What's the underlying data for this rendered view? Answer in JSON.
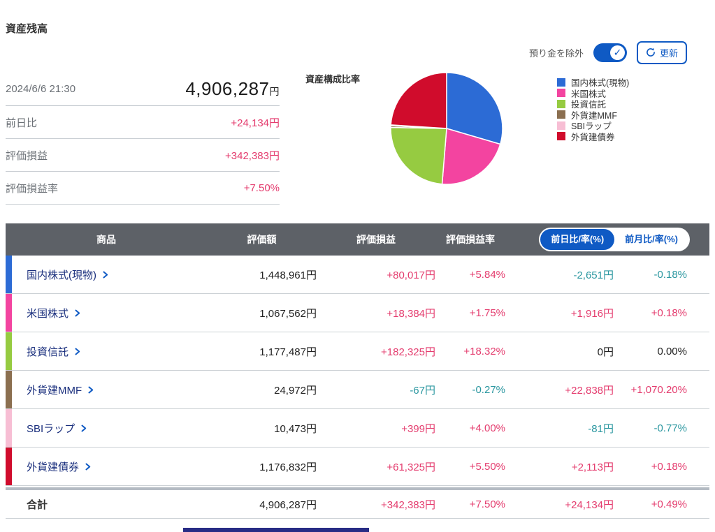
{
  "page": {
    "title": "資産残高"
  },
  "controls": {
    "toggle_label": "預り金を除外",
    "toggle_state": "on",
    "toggle_check": "✓",
    "refresh_label": "更新"
  },
  "summary": {
    "timestamp": "2024/6/6 21:30",
    "total_value": "4,906,287",
    "total_unit": "円",
    "rows": [
      {
        "label": "前日比",
        "value": "+24,134円",
        "state": "pos"
      },
      {
        "label": "評価損益",
        "value": "+342,383円",
        "state": "pos"
      },
      {
        "label": "評価損益率",
        "value": "+7.50%",
        "state": "pos"
      }
    ]
  },
  "chart_data": {
    "type": "pie",
    "title": "資産構成比率",
    "unit": "円",
    "total": 4906287,
    "legend_position": "right",
    "start_angle_deg": 0,
    "direction": "clockwise",
    "slices": [
      {
        "label": "国内株式(現物)",
        "value": 1448961,
        "percent": 29.53,
        "color": "#2c6bd5"
      },
      {
        "label": "米国株式",
        "value": 1067562,
        "percent": 21.76,
        "color": "#f344a0"
      },
      {
        "label": "投資信託",
        "value": 1177487,
        "percent": 24.0,
        "color": "#96cb41"
      },
      {
        "label": "外貨建MMF",
        "value": 24972,
        "percent": 0.51,
        "color": "#8b6f50"
      },
      {
        "label": "SBIラップ",
        "value": 10473,
        "percent": 0.21,
        "color": "#f7bed4"
      },
      {
        "label": "外貨建債券",
        "value": 1176832,
        "percent": 23.99,
        "color": "#d00c2c"
      }
    ]
  },
  "table": {
    "headers": {
      "product": "商品",
      "value": "評価額",
      "pl": "評価損益",
      "pl_rate": "評価損益率"
    },
    "period_toggle": [
      {
        "label": "前日比/率(%)",
        "selected": true
      },
      {
        "label": "前月比/率(%)",
        "selected": false
      }
    ],
    "rows": [
      {
        "product": "国内株式(現物)",
        "color": "#2c6bd5",
        "value": "1,448,961円",
        "pl": {
          "t": "+80,017円",
          "s": "pos"
        },
        "pl_rate": {
          "t": "+5.84%",
          "s": "pos"
        },
        "day": {
          "t": "-2,651円",
          "s": "neg"
        },
        "day_rate": {
          "t": "-0.18%",
          "s": "neg"
        }
      },
      {
        "product": "米国株式",
        "color": "#f344a0",
        "value": "1,067,562円",
        "pl": {
          "t": "+18,384円",
          "s": "pos"
        },
        "pl_rate": {
          "t": "+1.75%",
          "s": "pos"
        },
        "day": {
          "t": "+1,916円",
          "s": "pos"
        },
        "day_rate": {
          "t": "+0.18%",
          "s": "pos"
        }
      },
      {
        "product": "投資信託",
        "color": "#96cb41",
        "value": "1,177,487円",
        "pl": {
          "t": "+182,325円",
          "s": "pos"
        },
        "pl_rate": {
          "t": "+18.32%",
          "s": "pos"
        },
        "day": {
          "t": "0円",
          "s": "flat"
        },
        "day_rate": {
          "t": "0.00%",
          "s": "flat"
        }
      },
      {
        "product": "外貨建MMF",
        "color": "#8b6f50",
        "value": "24,972円",
        "pl": {
          "t": "-67円",
          "s": "neg"
        },
        "pl_rate": {
          "t": "-0.27%",
          "s": "neg"
        },
        "day": {
          "t": "+22,838円",
          "s": "pos"
        },
        "day_rate": {
          "t": "+1,070.20%",
          "s": "pos"
        }
      },
      {
        "product": "SBIラップ",
        "color": "#f7bed4",
        "value": "10,473円",
        "pl": {
          "t": "+399円",
          "s": "pos"
        },
        "pl_rate": {
          "t": "+4.00%",
          "s": "pos"
        },
        "day": {
          "t": "-81円",
          "s": "neg"
        },
        "day_rate": {
          "t": "-0.77%",
          "s": "neg"
        }
      },
      {
        "product": "外貨建債券",
        "color": "#d00c2c",
        "value": "1,176,832円",
        "pl": {
          "t": "+61,325円",
          "s": "pos"
        },
        "pl_rate": {
          "t": "+5.50%",
          "s": "pos"
        },
        "day": {
          "t": "+2,113円",
          "s": "pos"
        },
        "day_rate": {
          "t": "+0.18%",
          "s": "pos"
        }
      }
    ],
    "total": {
      "label": "合計",
      "value": "4,906,287円",
      "pl": "+342,383円",
      "pl_rate": "+7.50%",
      "day": "+24,134円",
      "day_rate": "+0.49%"
    }
  }
}
